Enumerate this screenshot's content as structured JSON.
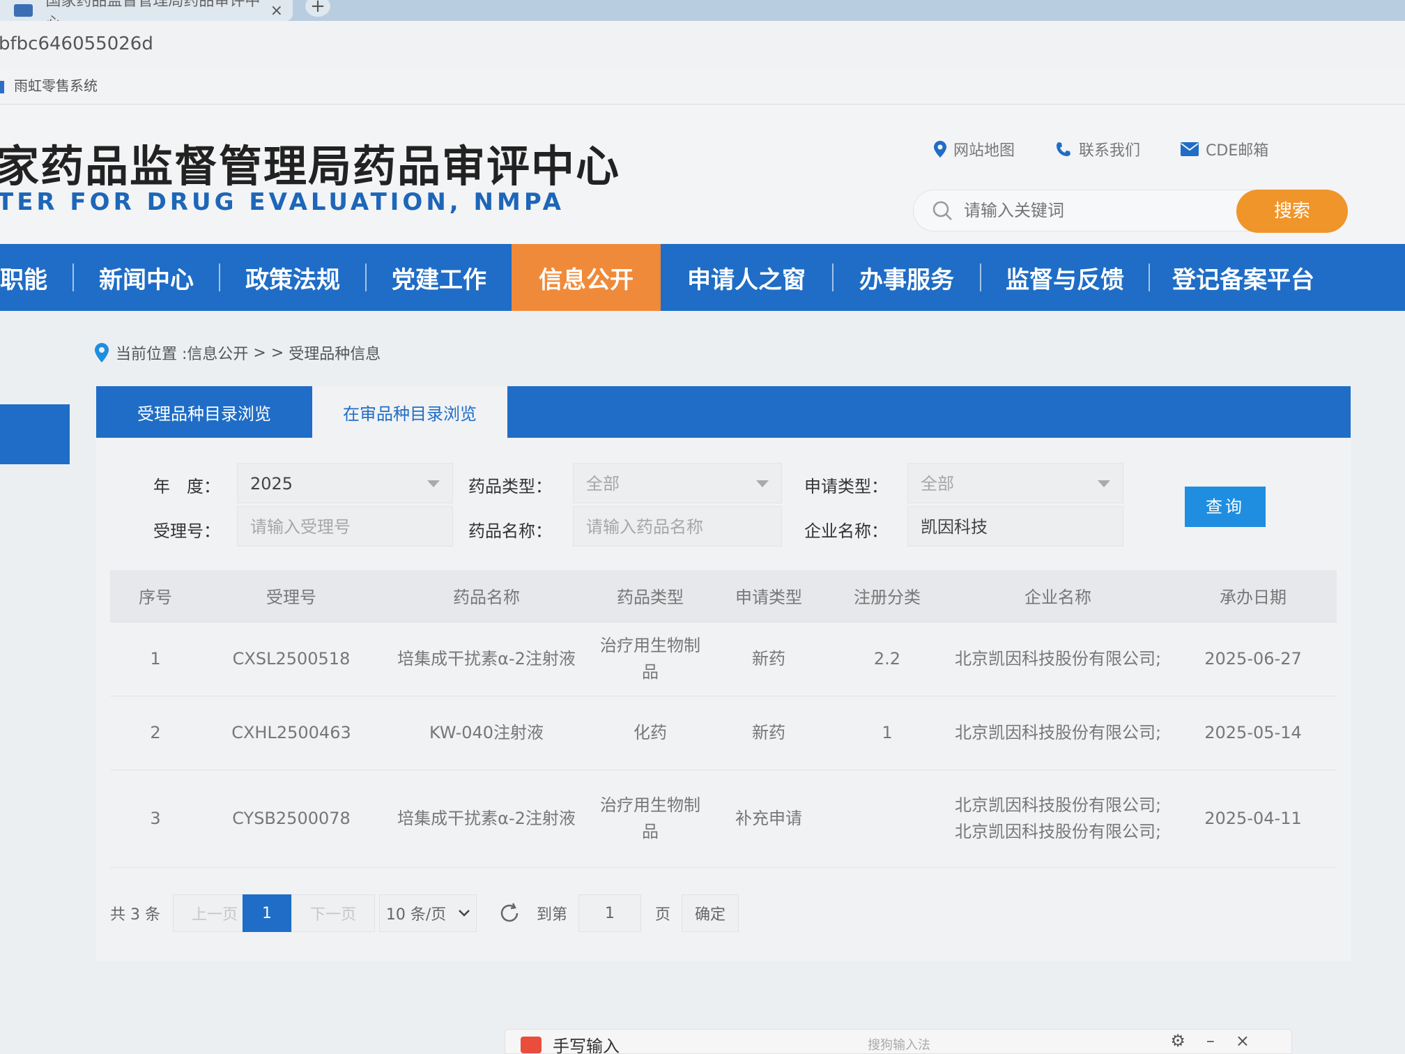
{
  "browser": {
    "tab_title": "国家药品监督管理局药品审评中心",
    "new_tab": "+",
    "close": "×",
    "url": "bfbc646055026d",
    "bookmark": "雨虹零售系统"
  },
  "header": {
    "title_cn": "家药品监督管理局药品审评中心",
    "title_en": "TER FOR DRUG EVALUATION, NMPA",
    "links": {
      "sitemap": "网站地图",
      "contact": "联系我们",
      "mail": "CDE邮箱"
    },
    "search_placeholder": "请输入关键词",
    "search_button": "搜索"
  },
  "nav": {
    "items": [
      "职能",
      "新闻中心",
      "政策法规",
      "党建工作",
      "信息公开",
      "申请人之窗",
      "办事服务",
      "监督与反馈",
      "登记备案平台"
    ],
    "active": "信息公开"
  },
  "breadcrumb": {
    "prefix": "当前位置 : ",
    "level1": "信息公开",
    "sep": " > > ",
    "level2": "受理品种信息"
  },
  "tabs": [
    "受理品种目录浏览",
    "在审品种目录浏览"
  ],
  "filters": {
    "year_label": "年　度：",
    "year_value": "2025",
    "drug_type_label": "药品类型：",
    "drug_type_value": "全部",
    "apply_type_label": "申请类型：",
    "apply_type_value": "全部",
    "accept_no_label": "受理号：",
    "accept_no_placeholder": "请输入受理号",
    "drug_name_label": "药品名称：",
    "drug_name_placeholder": "请输入药品名称",
    "company_label": "企业名称：",
    "company_value": "凯因科技",
    "query_button": "查询"
  },
  "table": {
    "headers": [
      "序号",
      "受理号",
      "药品名称",
      "药品类型",
      "申请类型",
      "注册分类",
      "企业名称",
      "承办日期"
    ],
    "rows": [
      [
        "1",
        "CXSL2500518",
        "培集成干扰素α-2注射液",
        "治疗用生物制品",
        "新药",
        "2.2",
        "北京凯因科技股份有限公司;",
        "2025-06-27"
      ],
      [
        "2",
        "CXHL2500463",
        "KW-040注射液",
        "化药",
        "新药",
        "1",
        "北京凯因科技股份有限公司;",
        "2025-05-14"
      ],
      [
        "3",
        "CYSB2500078",
        "培集成干扰素α-2注射液",
        "治疗用生物制品",
        "补充申请",
        "",
        "北京凯因科技股份有限公司;北京凯因科技股份有限公司;",
        "2025-04-11"
      ]
    ]
  },
  "pager": {
    "total": "共 3 条",
    "prev": "上一页",
    "current": "1",
    "next": "下一页",
    "page_size": "10 条/页",
    "goto_label": "到第",
    "goto_value": "1",
    "page_unit": "页",
    "confirm": "确定"
  },
  "ime": {
    "title": "手写输入",
    "hint": "搜狗输入法"
  }
}
